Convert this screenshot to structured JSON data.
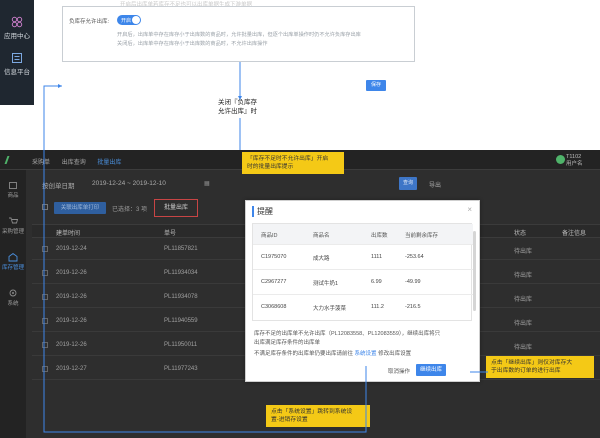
{
  "top_panel": {
    "sidebar": [
      {
        "label": "应用中心",
        "icon": "grid-icon"
      },
      {
        "label": "信息平台",
        "icon": "info-icon"
      }
    ],
    "faded_text": "开启后出库单若库存不足也可以出库单据生成下游单据",
    "setting_label": "负库存允许出库:",
    "toggle_text": "开启",
    "desc_lines": [
      "开启后，出库单中存在库存小于出库数的商品时，允许批量出库，但逐个出库单操作时仍不允许负库存出库",
      "关闭后，出库单中存在库存小于出库数的商品时，不允许出库操作"
    ],
    "save_label": "保存"
  },
  "mid_caption": [
    "关闭『负库存",
    "允许出库』时"
  ],
  "app": {
    "nav": [
      "采购单",
      "出库查询",
      "批量出库"
    ],
    "nav_current": 2,
    "user": [
      "T1102",
      "用户名"
    ],
    "sidebar": [
      {
        "label": "商品",
        "icon": "box-icon"
      },
      {
        "label": "采购管理",
        "icon": "cart-icon"
      },
      {
        "label": "库存管理",
        "icon": "warehouse-icon"
      },
      {
        "label": "系统",
        "icon": "gear-icon"
      }
    ],
    "filter": {
      "select": "按创单日期",
      "date_range": "2019-12-24 ~ 2019-12-10",
      "search_label": "查询",
      "export_label": "导出"
    },
    "batch": {
      "button": "关联出库单打印",
      "selected": "已选择：3 项",
      "batch_out": "批量出库"
    },
    "columns": [
      "建单时间",
      "单号",
      "状态",
      "备注信息"
    ],
    "rows": [
      {
        "date": "2019-12-24",
        "no": "PL11857821",
        "status": "待出库"
      },
      {
        "date": "2019-12-26",
        "no": "PL11934034",
        "status": "待出库"
      },
      {
        "date": "2019-12-26",
        "no": "PL11934078",
        "status": "待出库"
      },
      {
        "date": "2019-12-26",
        "no": "PL11940559",
        "status": "待出库"
      },
      {
        "date": "2019-12-26",
        "no": "PL11950011",
        "status": "待出库"
      },
      {
        "date": "2019-12-27",
        "no": "PL11977243",
        "status": "待出库"
      }
    ]
  },
  "modal": {
    "title": "提醒",
    "close": "×",
    "columns": [
      "商品ID",
      "商品名",
      "出库数",
      "当前剩余库存"
    ],
    "rows": [
      {
        "id": "C1975070",
        "name": "成大路",
        "qty": "1111",
        "stock": "-253.64"
      },
      {
        "id": "C2967277",
        "name": "测试牛奶1",
        "qty": "6.99",
        "stock": "-49.99"
      },
      {
        "id": "C3068608",
        "name": "大力水手菠菜",
        "qty": "111.2",
        "stock": "-216.5"
      }
    ],
    "note1": "库存不足的出库单不允许出库（PL12083558、PL12083559），继续出库将只",
    "note2": "出库满足库存条件的出库单",
    "note3_pre": "不满足库存条件的出库单仍要出库请前往",
    "note3_link": "系统设置",
    "note3_post": "修改出库设置",
    "cancel": "取消操作",
    "continue": "继续出库"
  },
  "callouts": {
    "c1": [
      "「库存不足时不允许出库」开启",
      "时的批量出库提示"
    ],
    "c2": [
      "点击「继续出库」则仅对库存大",
      "于出库数的订单的进行出库"
    ],
    "c3": [
      "点击「系统设置」跳转到系统设",
      "置-进销存设置"
    ]
  },
  "colors": {
    "accent": "#3e86ea",
    "callout": "#f4c916",
    "app_bg": "#2e2e2e",
    "danger": "#c84545"
  }
}
